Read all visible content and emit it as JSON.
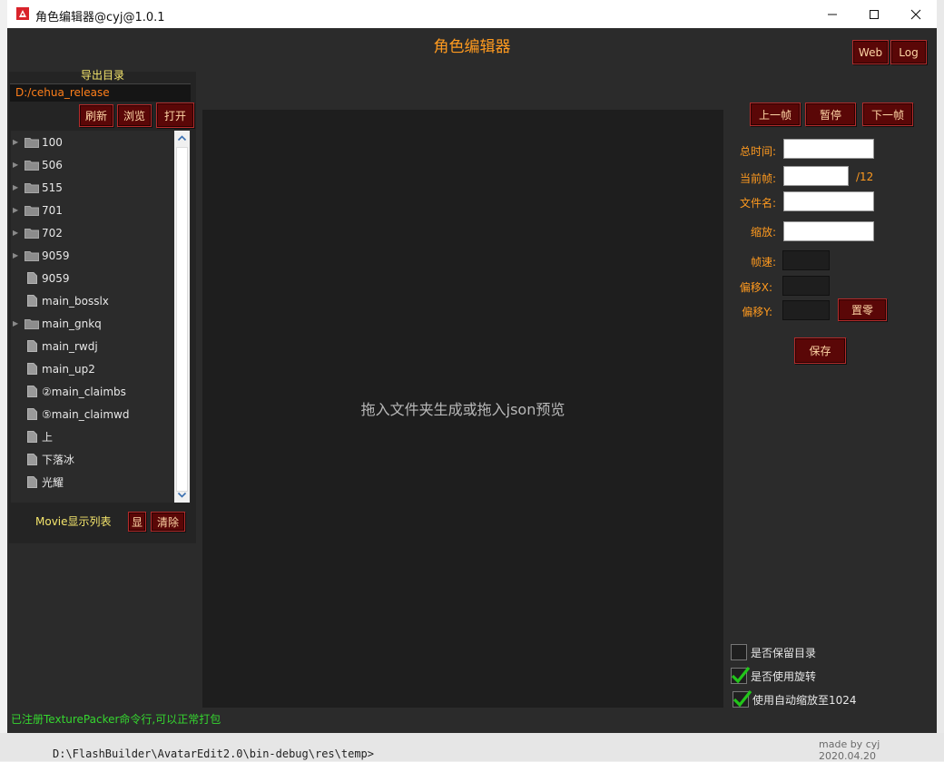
{
  "window": {
    "title": "角色编辑器@cyj@1.0.1"
  },
  "header": {
    "title": "角色编辑器",
    "web_label": "Web",
    "log_label": "Log"
  },
  "export": {
    "label": "导出目录",
    "path": "D:/cehua_release",
    "refresh_label": "刷新",
    "browse_label": "浏览",
    "open_label": "打开"
  },
  "tree": {
    "items": [
      {
        "label": "100",
        "kind": "folder"
      },
      {
        "label": "506",
        "kind": "folder"
      },
      {
        "label": "515",
        "kind": "folder"
      },
      {
        "label": "701",
        "kind": "folder"
      },
      {
        "label": "702",
        "kind": "folder"
      },
      {
        "label": "9059",
        "kind": "folder"
      },
      {
        "label": "9059",
        "kind": "file"
      },
      {
        "label": "main_bosslx",
        "kind": "file"
      },
      {
        "label": "main_gnkq",
        "kind": "folder"
      },
      {
        "label": "main_rwdj",
        "kind": "file"
      },
      {
        "label": "main_up2",
        "kind": "file"
      },
      {
        "label": "②main_claimbs",
        "kind": "file"
      },
      {
        "label": "⑤main_claimwd",
        "kind": "file"
      },
      {
        "label": "上",
        "kind": "file"
      },
      {
        "label": "下落冰",
        "kind": "file"
      },
      {
        "label": "光耀",
        "kind": "file"
      }
    ]
  },
  "movie": {
    "label": "Movie显示列表",
    "show_label": "显",
    "clear_label": "清除"
  },
  "stage": {
    "hint": "拖入文件夹生成或拖入json预览"
  },
  "playback": {
    "prev_label": "上一帧",
    "pause_label": "暂停",
    "next_label": "下一帧"
  },
  "fields": {
    "total_time_label": "总时间:",
    "current_frame_label": "当前帧:",
    "frame_total": "/12",
    "filename_label": "文件名:",
    "scale_label": "缩放:",
    "fps_label": "帧速:",
    "offset_x_label": "偏移X:",
    "offset_y_label": "偏移Y:",
    "reset_label": "置零",
    "save_label": "保存"
  },
  "options": [
    {
      "label": "是否保留目录",
      "checked": false
    },
    {
      "label": "是否使用旋转",
      "checked": true
    },
    {
      "label": "使用自动缩放至1024",
      "checked": true
    }
  ],
  "status": {
    "text": "已注册TexturePacker命令行,可以正常打包"
  },
  "credit": {
    "text": "made by cyj 2020.04.20"
  },
  "desktop": {
    "path_text": "D:\\FlashBuilder\\AvatarEdit2.0\\bin-debug\\res\\temp>"
  },
  "colors": {
    "accent": "#ff9a1f",
    "button": "#5a0707",
    "status": "#35d62f",
    "background": "#2b2b2b"
  }
}
